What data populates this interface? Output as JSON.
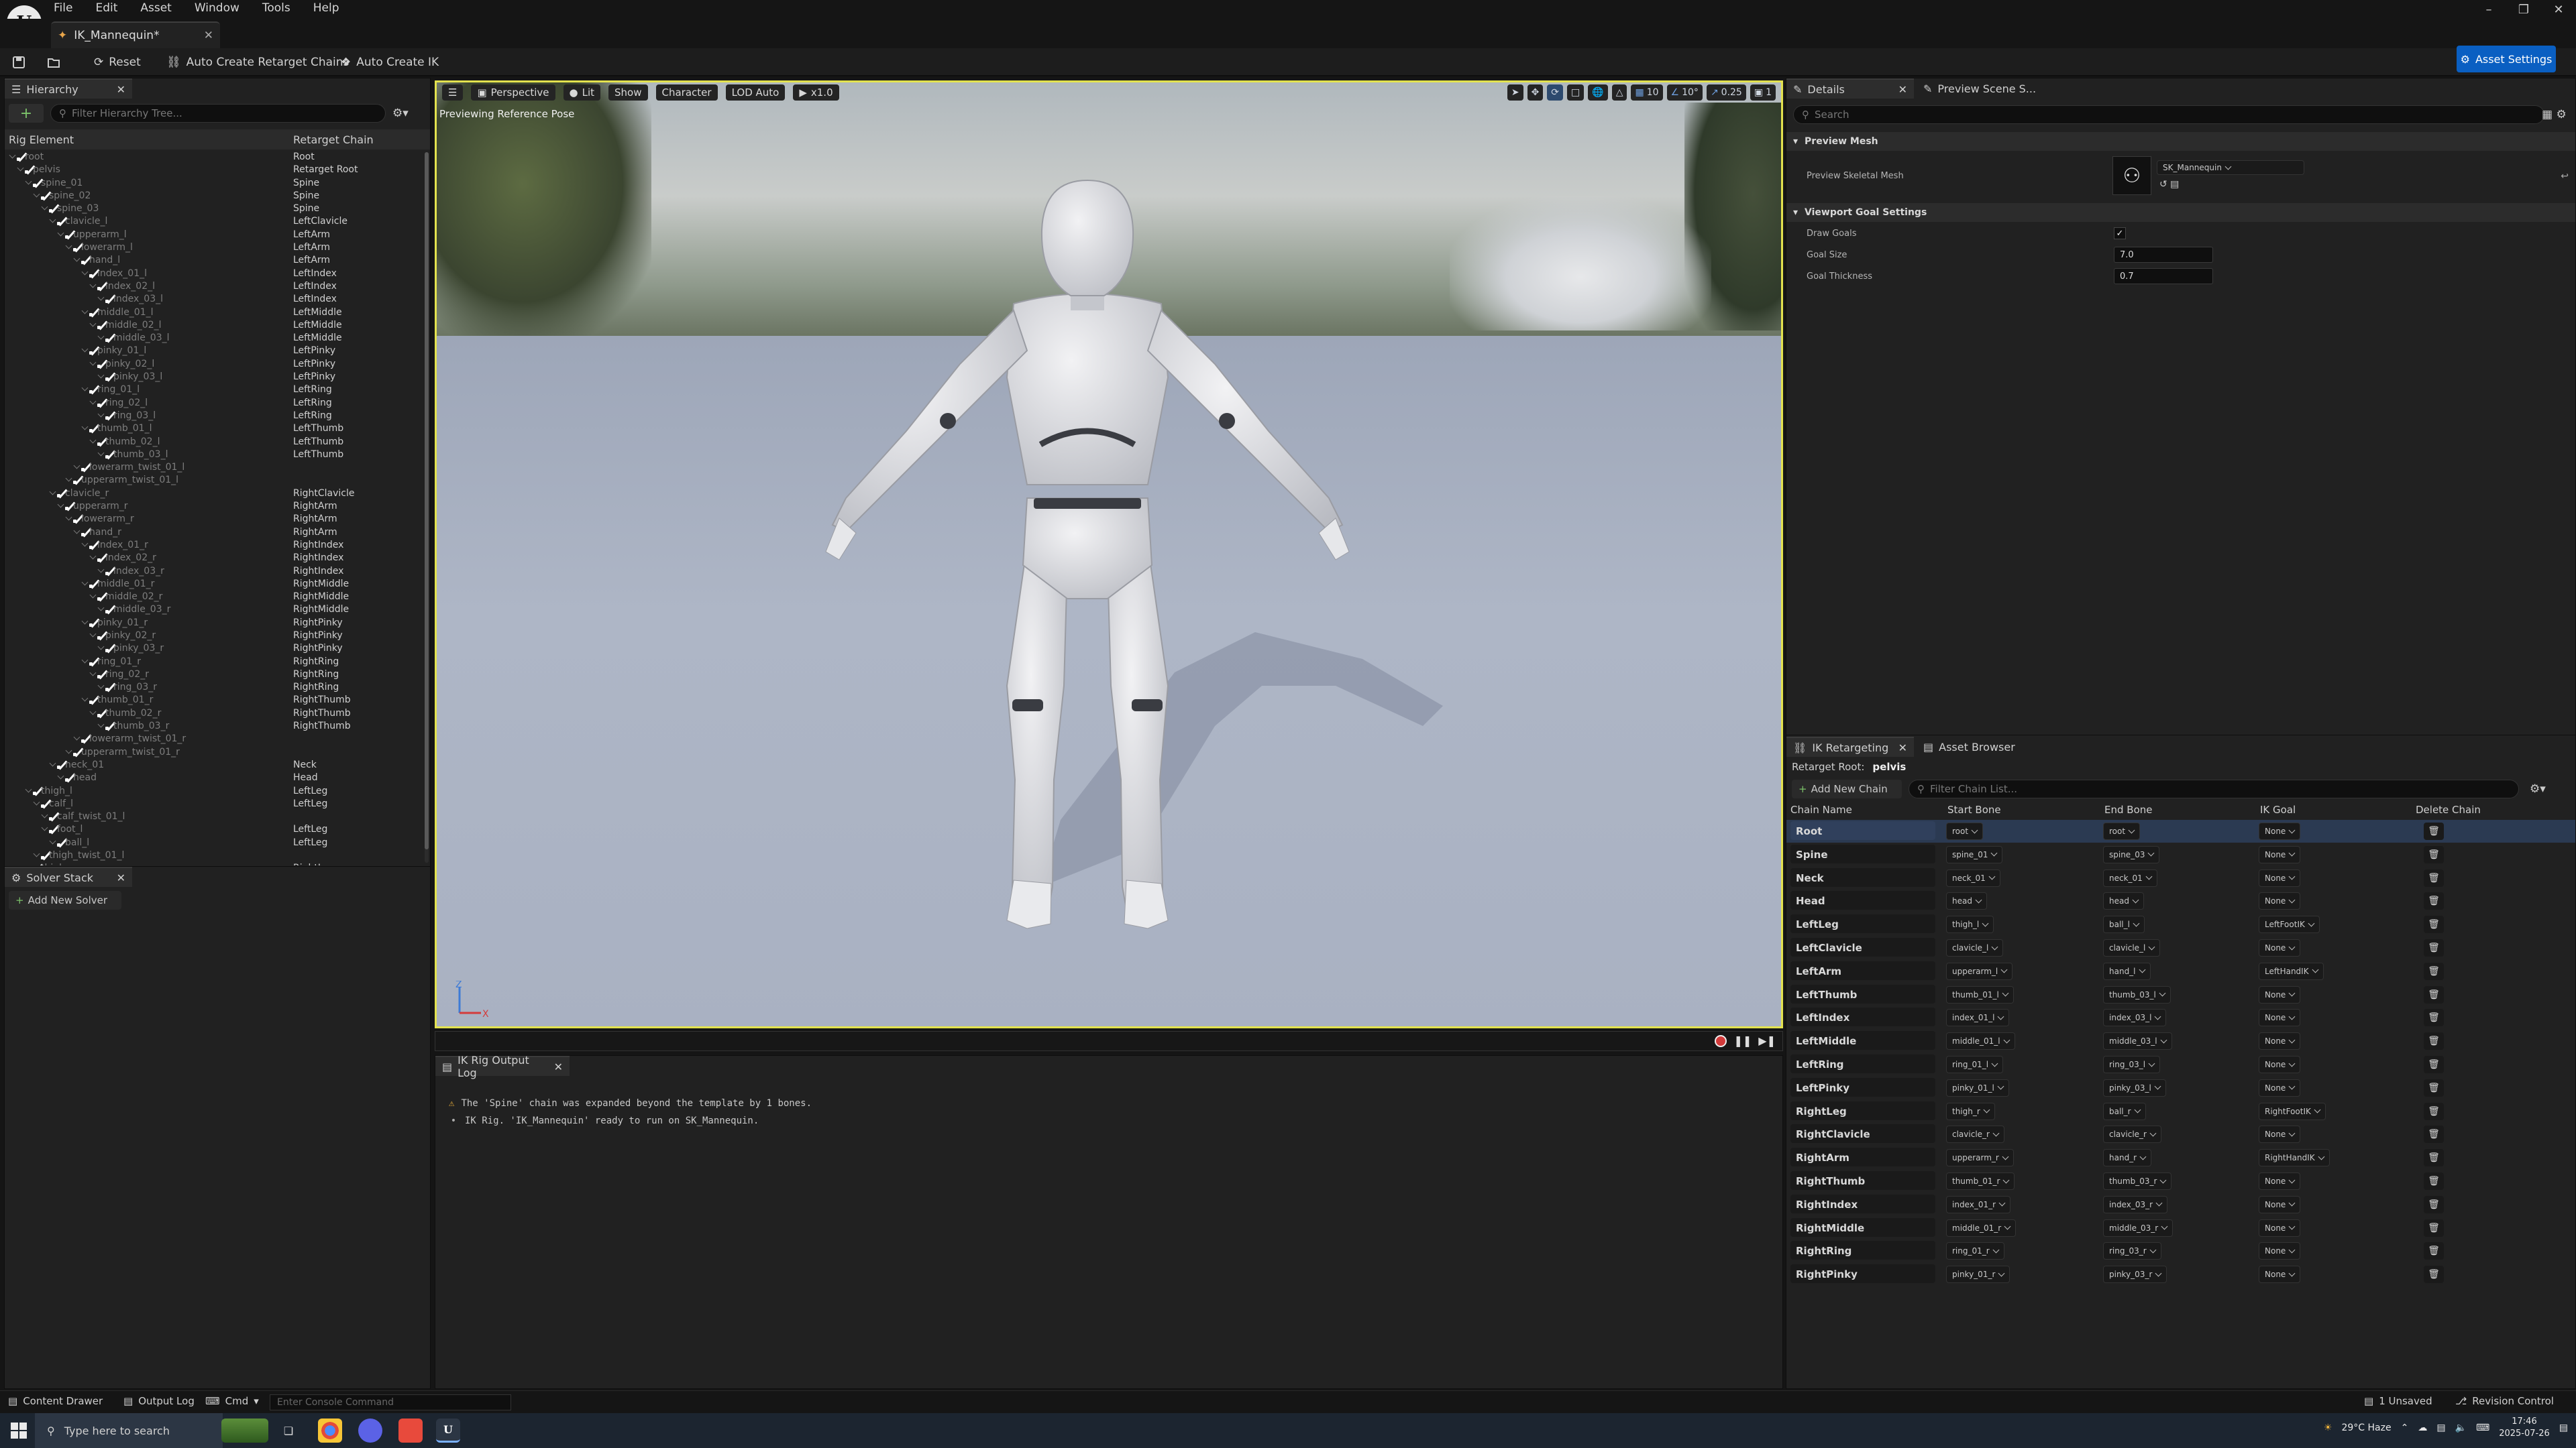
{
  "menubar": {
    "items": [
      "File",
      "Edit",
      "Asset",
      "Window",
      "Tools",
      "Help"
    ]
  },
  "doctab": {
    "title": "IK_Mannequin*"
  },
  "toolbar": {
    "reset": "Reset",
    "auto_chains": "Auto Create Retarget Chains",
    "auto_ik": "Auto Create IK",
    "asset_settings": "Asset Settings"
  },
  "hierarchy": {
    "tab": "Hierarchy",
    "filter_placeholder": "Filter Hierarchy Tree...",
    "col_element": "Rig Element",
    "col_chain": "Retarget Chain",
    "rows": [
      {
        "n": "root",
        "d": 0,
        "c": "Root"
      },
      {
        "n": "pelvis",
        "d": 1,
        "c": "Retarget Root"
      },
      {
        "n": "spine_01",
        "d": 2,
        "c": "Spine"
      },
      {
        "n": "spine_02",
        "d": 3,
        "c": "Spine"
      },
      {
        "n": "spine_03",
        "d": 4,
        "c": "Spine"
      },
      {
        "n": "clavicle_l",
        "d": 5,
        "c": "LeftClavicle"
      },
      {
        "n": "upperarm_l",
        "d": 6,
        "c": "LeftArm"
      },
      {
        "n": "lowerarm_l",
        "d": 7,
        "c": "LeftArm"
      },
      {
        "n": "hand_l",
        "d": 8,
        "c": "LeftArm"
      },
      {
        "n": "index_01_l",
        "d": 9,
        "c": "LeftIndex"
      },
      {
        "n": "index_02_l",
        "d": 10,
        "c": "LeftIndex"
      },
      {
        "n": "index_03_l",
        "d": 11,
        "c": "LeftIndex"
      },
      {
        "n": "middle_01_l",
        "d": 9,
        "c": "LeftMiddle"
      },
      {
        "n": "middle_02_l",
        "d": 10,
        "c": "LeftMiddle"
      },
      {
        "n": "middle_03_l",
        "d": 11,
        "c": "LeftMiddle"
      },
      {
        "n": "pinky_01_l",
        "d": 9,
        "c": "LeftPinky"
      },
      {
        "n": "pinky_02_l",
        "d": 10,
        "c": "LeftPinky"
      },
      {
        "n": "pinky_03_l",
        "d": 11,
        "c": "LeftPinky"
      },
      {
        "n": "ring_01_l",
        "d": 9,
        "c": "LeftRing"
      },
      {
        "n": "ring_02_l",
        "d": 10,
        "c": "LeftRing"
      },
      {
        "n": "ring_03_l",
        "d": 11,
        "c": "LeftRing"
      },
      {
        "n": "thumb_01_l",
        "d": 9,
        "c": "LeftThumb"
      },
      {
        "n": "thumb_02_l",
        "d": 10,
        "c": "LeftThumb"
      },
      {
        "n": "thumb_03_l",
        "d": 11,
        "c": "LeftThumb"
      },
      {
        "n": "lowerarm_twist_01_l",
        "d": 8,
        "c": ""
      },
      {
        "n": "upperarm_twist_01_l",
        "d": 7,
        "c": ""
      },
      {
        "n": "clavicle_r",
        "d": 5,
        "c": "RightClavicle"
      },
      {
        "n": "upperarm_r",
        "d": 6,
        "c": "RightArm"
      },
      {
        "n": "lowerarm_r",
        "d": 7,
        "c": "RightArm"
      },
      {
        "n": "hand_r",
        "d": 8,
        "c": "RightArm"
      },
      {
        "n": "index_01_r",
        "d": 9,
        "c": "RightIndex"
      },
      {
        "n": "index_02_r",
        "d": 10,
        "c": "RightIndex"
      },
      {
        "n": "index_03_r",
        "d": 11,
        "c": "RightIndex"
      },
      {
        "n": "middle_01_r",
        "d": 9,
        "c": "RightMiddle"
      },
      {
        "n": "middle_02_r",
        "d": 10,
        "c": "RightMiddle"
      },
      {
        "n": "middle_03_r",
        "d": 11,
        "c": "RightMiddle"
      },
      {
        "n": "pinky_01_r",
        "d": 9,
        "c": "RightPinky"
      },
      {
        "n": "pinky_02_r",
        "d": 10,
        "c": "RightPinky"
      },
      {
        "n": "pinky_03_r",
        "d": 11,
        "c": "RightPinky"
      },
      {
        "n": "ring_01_r",
        "d": 9,
        "c": "RightRing"
      },
      {
        "n": "ring_02_r",
        "d": 10,
        "c": "RightRing"
      },
      {
        "n": "ring_03_r",
        "d": 11,
        "c": "RightRing"
      },
      {
        "n": "thumb_01_r",
        "d": 9,
        "c": "RightThumb"
      },
      {
        "n": "thumb_02_r",
        "d": 10,
        "c": "RightThumb"
      },
      {
        "n": "thumb_03_r",
        "d": 11,
        "c": "RightThumb"
      },
      {
        "n": "lowerarm_twist_01_r",
        "d": 8,
        "c": ""
      },
      {
        "n": "upperarm_twist_01_r",
        "d": 7,
        "c": ""
      },
      {
        "n": "neck_01",
        "d": 5,
        "c": "Neck"
      },
      {
        "n": "head",
        "d": 6,
        "c": "Head"
      },
      {
        "n": "thigh_l",
        "d": 2,
        "c": "LeftLeg"
      },
      {
        "n": "calf_l",
        "d": 3,
        "c": "LeftLeg"
      },
      {
        "n": "calf_twist_01_l",
        "d": 4,
        "c": ""
      },
      {
        "n": "foot_l",
        "d": 4,
        "c": "LeftLeg"
      },
      {
        "n": "ball_l",
        "d": 5,
        "c": "LeftLeg"
      },
      {
        "n": "thigh_twist_01_l",
        "d": 3,
        "c": ""
      },
      {
        "n": "thigh_r",
        "d": 2,
        "c": "RightLeg"
      }
    ]
  },
  "solver": {
    "tab": "Solver Stack",
    "add": "Add New Solver"
  },
  "viewport": {
    "perspective": "Perspective",
    "lit": "Lit",
    "show": "Show",
    "character": "Character",
    "lod": "LOD Auto",
    "speed": "x1.0",
    "preview": "Previewing Reference Pose",
    "snap_grid": "10",
    "snap_angle": "10°",
    "cam_speed": "0.25",
    "screens": "1"
  },
  "outputlog": {
    "tab": "IK Rig Output Log",
    "lines": [
      "The 'Spine' chain was expanded beyond the template by 1 bones.",
      "IK Rig. 'IK_Mannequin' ready to run on SK_Mannequin."
    ]
  },
  "details": {
    "tab": "Details",
    "tab2": "Preview Scene S...",
    "search_placeholder": "Search",
    "sec_mesh": "Preview Mesh",
    "mesh_label": "Preview Skeletal Mesh",
    "mesh_value": "SK_Mannequin",
    "sec_goal": "Viewport Goal Settings",
    "draw_goals_label": "Draw Goals",
    "goal_size_label": "Goal Size",
    "goal_size": "7.0",
    "goal_thickness_label": "Goal Thickness",
    "goal_thickness": "0.7"
  },
  "ikret": {
    "tab": "IK Retargeting",
    "tab2": "Asset Browser",
    "root_label": "Retarget Root:",
    "root_value": "pelvis",
    "add_chain": "Add New Chain",
    "filter_placeholder": "Filter Chain List...",
    "col_name": "Chain Name",
    "col_start": "Start Bone",
    "col_end": "End Bone",
    "col_goal": "IK Goal",
    "col_delete": "Delete Chain",
    "chains": [
      {
        "name": "Root",
        "start": "root",
        "end": "root",
        "goal": "None"
      },
      {
        "name": "Spine",
        "start": "spine_01",
        "end": "spine_03",
        "goal": "None"
      },
      {
        "name": "Neck",
        "start": "neck_01",
        "end": "neck_01",
        "goal": "None"
      },
      {
        "name": "Head",
        "start": "head",
        "end": "head",
        "goal": "None"
      },
      {
        "name": "LeftLeg",
        "start": "thigh_l",
        "end": "ball_l",
        "goal": "LeftFootIK"
      },
      {
        "name": "LeftClavicle",
        "start": "clavicle_l",
        "end": "clavicle_l",
        "goal": "None"
      },
      {
        "name": "LeftArm",
        "start": "upperarm_l",
        "end": "hand_l",
        "goal": "LeftHandIK"
      },
      {
        "name": "LeftThumb",
        "start": "thumb_01_l",
        "end": "thumb_03_l",
        "goal": "None"
      },
      {
        "name": "LeftIndex",
        "start": "index_01_l",
        "end": "index_03_l",
        "goal": "None"
      },
      {
        "name": "LeftMiddle",
        "start": "middle_01_l",
        "end": "middle_03_l",
        "goal": "None"
      },
      {
        "name": "LeftRing",
        "start": "ring_01_l",
        "end": "ring_03_l",
        "goal": "None"
      },
      {
        "name": "LeftPinky",
        "start": "pinky_01_l",
        "end": "pinky_03_l",
        "goal": "None"
      },
      {
        "name": "RightLeg",
        "start": "thigh_r",
        "end": "ball_r",
        "goal": "RightFootIK"
      },
      {
        "name": "RightClavicle",
        "start": "clavicle_r",
        "end": "clavicle_r",
        "goal": "None"
      },
      {
        "name": "RightArm",
        "start": "upperarm_r",
        "end": "hand_r",
        "goal": "RightHandIK"
      },
      {
        "name": "RightThumb",
        "start": "thumb_01_r",
        "end": "thumb_03_r",
        "goal": "None"
      },
      {
        "name": "RightIndex",
        "start": "index_01_r",
        "end": "index_03_r",
        "goal": "None"
      },
      {
        "name": "RightMiddle",
        "start": "middle_01_r",
        "end": "middle_03_r",
        "goal": "None"
      },
      {
        "name": "RightRing",
        "start": "ring_01_r",
        "end": "ring_03_r",
        "goal": "None"
      },
      {
        "name": "RightPinky",
        "start": "pinky_01_r",
        "end": "pinky_03_r",
        "goal": "None"
      }
    ]
  },
  "statusbar": {
    "content_drawer": "Content Drawer",
    "output_log": "Output Log",
    "cmd": "Cmd",
    "console_placeholder": "Enter Console Command",
    "unsaved": "1 Unsaved",
    "revision": "Revision Control"
  },
  "taskbar": {
    "search": "Type here to search",
    "weather": "29°C Haze",
    "time": "17:46",
    "date": "2025-07-26"
  },
  "colors": {
    "accent": "#0a5fc2",
    "viewport_border": "#e3e24e",
    "selected_row": "#2b3a52"
  }
}
